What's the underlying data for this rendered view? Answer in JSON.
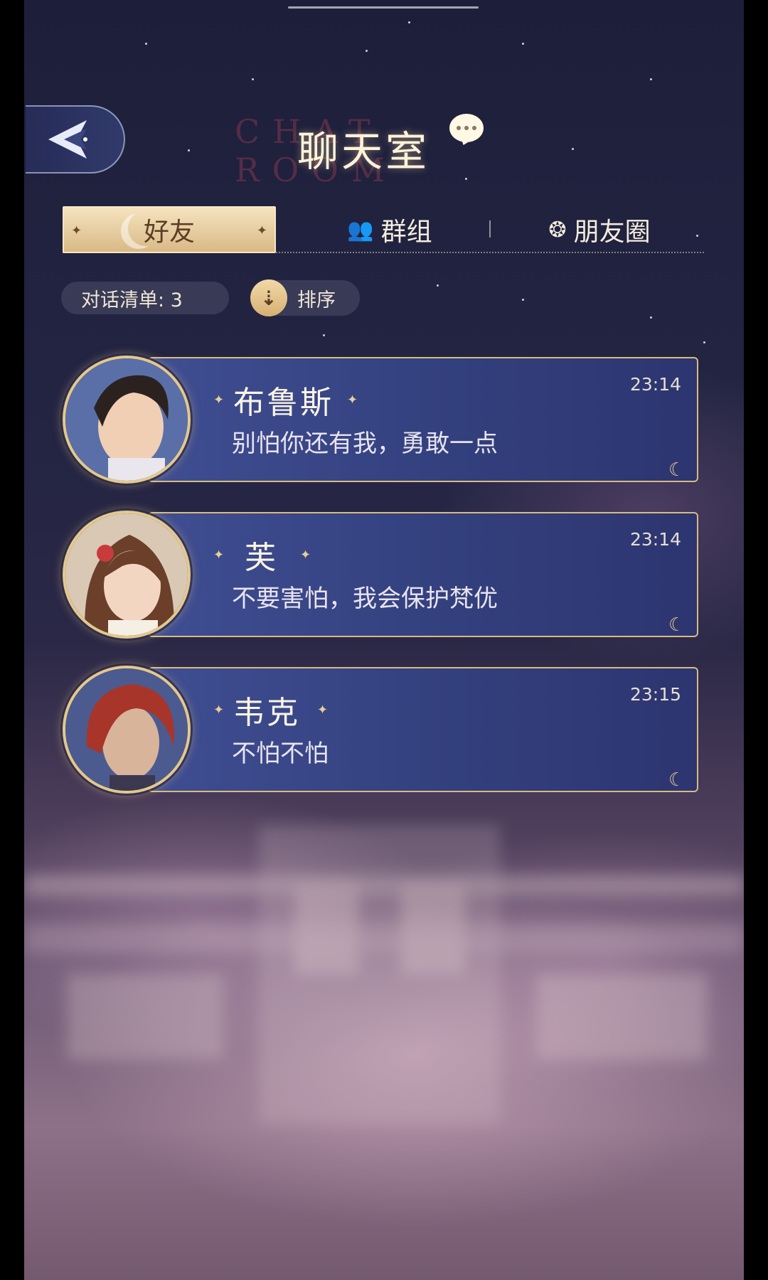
{
  "header": {
    "title": "聊天室",
    "title_bg": "CHAT ROOM"
  },
  "tabs": [
    {
      "label": "好友",
      "active": true
    },
    {
      "label": "群组",
      "active": false
    },
    {
      "label": "朋友圈",
      "active": false
    }
  ],
  "list_controls": {
    "count_label": "对话清单: 3",
    "sort_label": "排序"
  },
  "chats": [
    {
      "name": "布鲁斯",
      "message": "别怕你还有我，勇敢一点",
      "time": "23:14"
    },
    {
      "name": "芙",
      "message": "不要害怕，我会保护梵优",
      "time": "23:14"
    },
    {
      "name": "韦克",
      "message": "不怕不怕",
      "time": "23:15"
    }
  ],
  "colors": {
    "accent_gold": "#d8bb7e",
    "card_blue": "#3f4e92",
    "tab_active": "#e9cfa0"
  }
}
